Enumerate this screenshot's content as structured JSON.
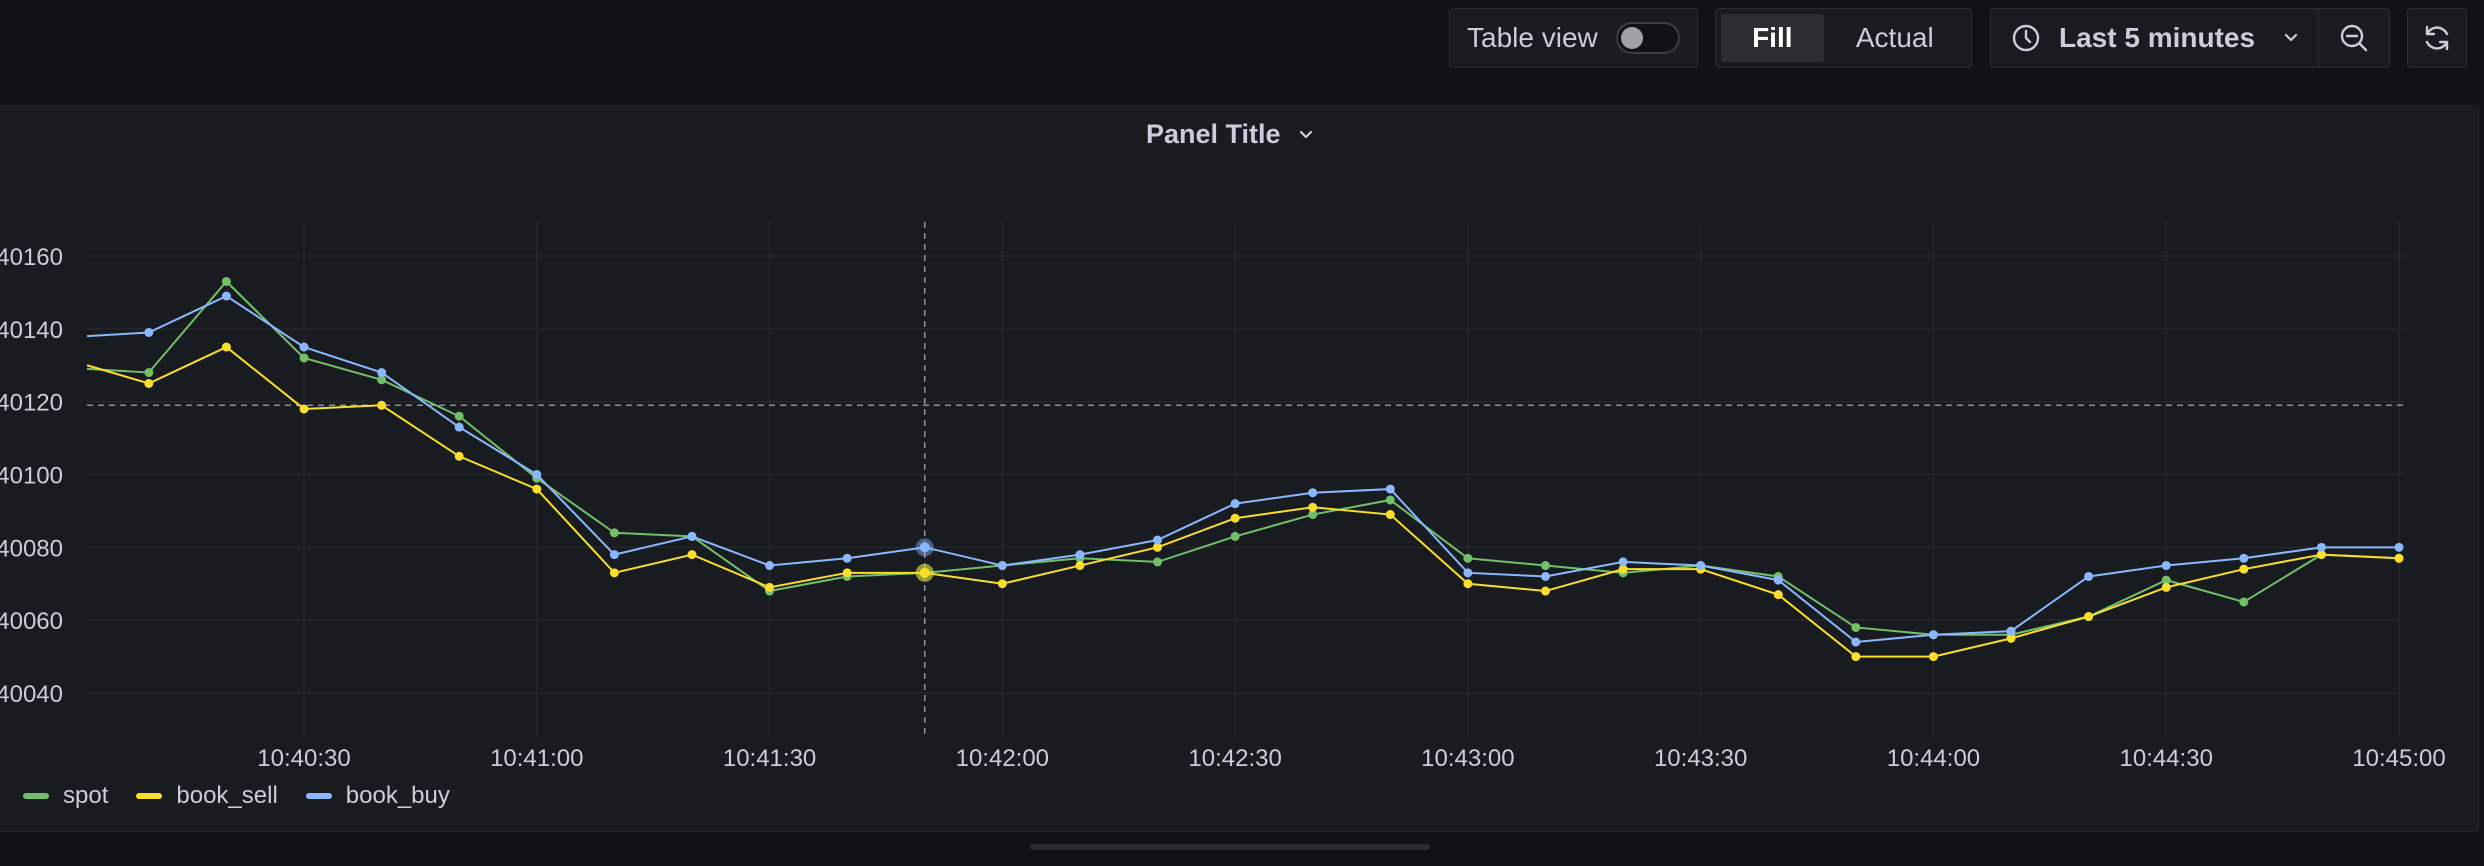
{
  "toolbar": {
    "table_view_label": "Table view",
    "fill_label": "Fill",
    "actual_label": "Actual",
    "time_range_label": "Last 5 minutes"
  },
  "icons": {
    "clock": "clock-icon",
    "chevron": "chevron-down-icon",
    "zoom_out": "zoom-out-icon",
    "refresh": "refresh-icon"
  },
  "panel": {
    "title": "Panel Title"
  },
  "chart_data": {
    "type": "line",
    "title": "Panel Title",
    "xlabel": "",
    "ylabel": "",
    "x_ticks": [
      "10:40:30",
      "10:41:00",
      "10:41:30",
      "10:42:00",
      "10:42:30",
      "10:43:00",
      "10:43:30",
      "10:44:00",
      "10:44:30",
      "10:45:00"
    ],
    "y_ticks": [
      40040,
      40060,
      40080,
      40100,
      40120,
      40140,
      40160
    ],
    "ylim": [
      40030,
      40170
    ],
    "grid": true,
    "legend_placement": "bottom-left",
    "crosshair": {
      "x": "10:41:50",
      "y": 40119
    },
    "x": [
      "10:40:10",
      "10:40:20",
      "10:40:30",
      "10:40:40",
      "10:40:50",
      "10:41:00",
      "10:41:10",
      "10:41:20",
      "10:41:30",
      "10:41:40",
      "10:41:50",
      "10:42:00",
      "10:42:10",
      "10:42:20",
      "10:42:30",
      "10:42:40",
      "10:42:50",
      "10:43:00",
      "10:43:10",
      "10:43:20",
      "10:43:30",
      "10:43:40",
      "10:43:50",
      "10:44:00",
      "10:44:10",
      "10:44:20",
      "10:44:30",
      "10:44:40",
      "10:44:50",
      "10:45:00"
    ],
    "series": [
      {
        "name": "spot",
        "color": "#73bf69",
        "values": [
          40128,
          40153,
          40132,
          40126,
          40116,
          40099,
          40084,
          40083,
          40068,
          40072,
          40073,
          40075,
          40077,
          40076,
          40083,
          40089,
          40093,
          40077,
          40075,
          40073,
          40075,
          40072,
          40058,
          40056,
          40056,
          40061,
          40071,
          40065,
          40078,
          40077
        ]
      },
      {
        "name": "book_sell",
        "color": "#fade2a",
        "values": [
          40125,
          40135,
          40118,
          40119,
          40105,
          40096,
          40073,
          40078,
          40069,
          40073,
          40073,
          40070,
          40075,
          40080,
          40088,
          40091,
          40089,
          40070,
          40068,
          40074,
          40074,
          40067,
          40050,
          40050,
          40055,
          40061,
          40069,
          40074,
          40078,
          40077
        ]
      },
      {
        "name": "book_buy",
        "color": "#8ab8ff",
        "values": [
          40139,
          40149,
          40135,
          40128,
          40113,
          40100,
          40078,
          40083,
          40075,
          40077,
          40080,
          40075,
          40078,
          40082,
          40092,
          40095,
          40096,
          40073,
          40072,
          40076,
          40075,
          40071,
          40054,
          40056,
          40057,
          40072,
          40075,
          40077,
          40080,
          40080
        ]
      }
    ],
    "left_edge_values": {
      "spot": 40129,
      "book_sell": 40130,
      "book_buy": 40138
    }
  }
}
